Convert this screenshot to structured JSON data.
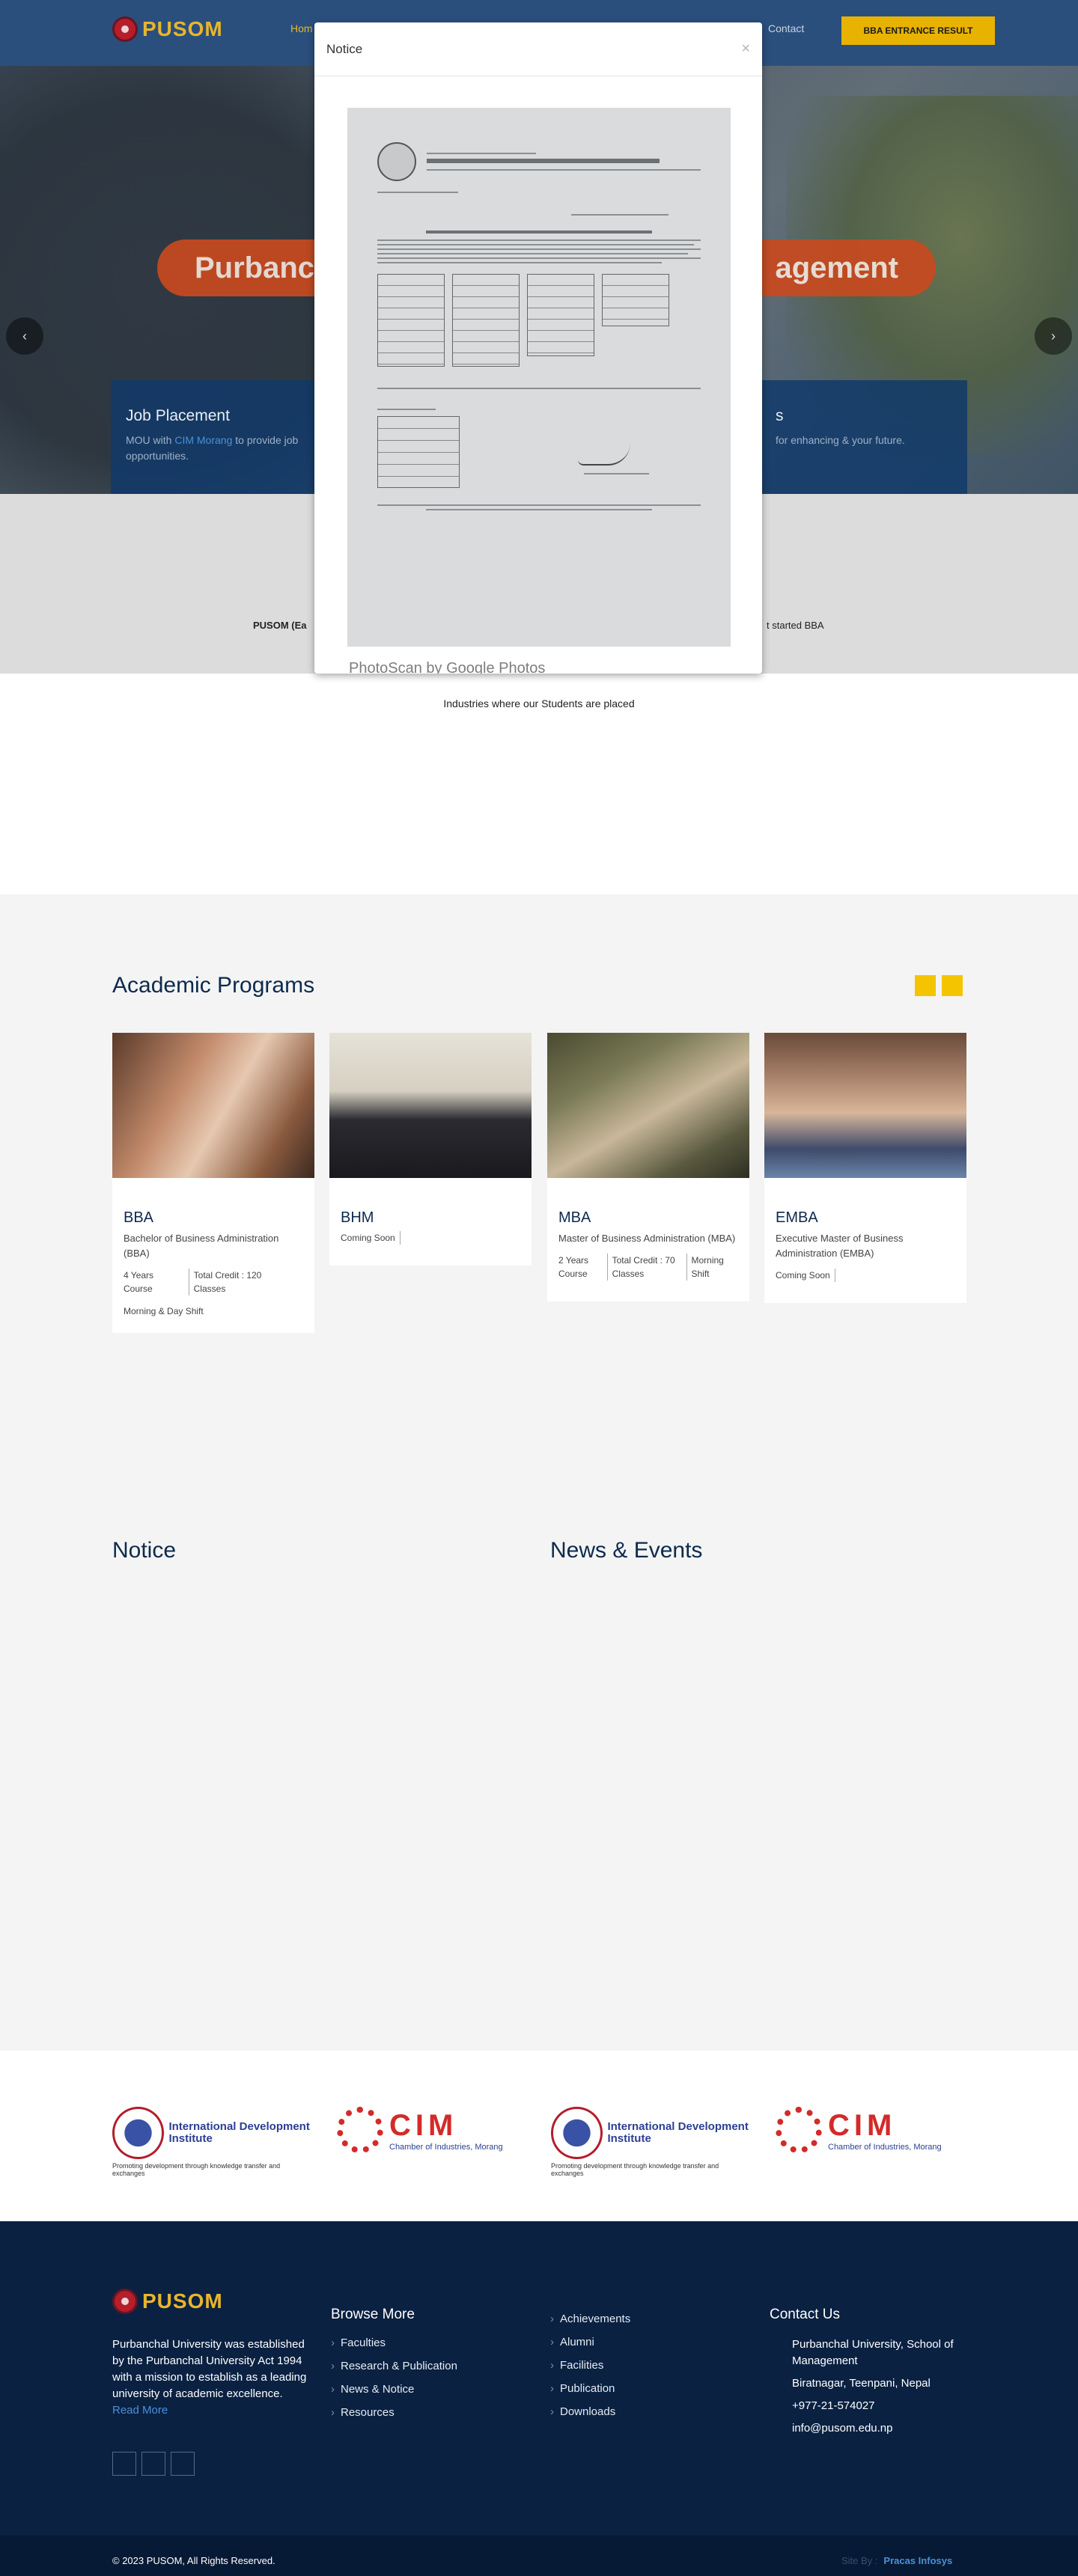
{
  "header": {
    "logo_text": "PUSOM",
    "nav_home": "Hom",
    "nav_contact": "Contact",
    "result_button": "BBA ENTRANCE RESULT"
  },
  "hero": {
    "title_left": "Purbanch",
    "title_right": "agement",
    "arrow_left": "‹",
    "arrow_right": "›",
    "features": [
      {
        "title": "Job Placement",
        "text_before": "MOU with ",
        "link": "CIM Morang",
        "text_after": " to provide job opportunities."
      },
      {
        "title": "s",
        "text": "for enhancing & your future."
      }
    ]
  },
  "intro": {
    "text_left": "PUSOM (Ea",
    "text_right": "t started BBA",
    "industries": "Industries where our Students are placed"
  },
  "modal": {
    "title": "Notice",
    "close": "×",
    "photoscan": "PhotoScan by Google Photos"
  },
  "academic": {
    "title": "Academic Programs",
    "programs": [
      {
        "code": "BBA",
        "name": "Bachelor of Business Administration (BBA)",
        "meta": [
          "4 Years Course",
          "Total Credit : 120 Classes"
        ],
        "shift": "Morning & Day Shift"
      },
      {
        "code": "BHM",
        "name": "",
        "meta": [
          "Coming Soon",
          ""
        ],
        "shift": ""
      },
      {
        "code": "MBA",
        "name": "Master of Business Administration (MBA)",
        "meta": [
          "2 Years Course",
          "Total Credit : 70 Classes",
          "Morning Shift"
        ],
        "shift": ""
      },
      {
        "code": "EMBA",
        "name": "Executive Master of Business Administration (EMBA)",
        "meta": [
          "Coming Soon",
          ""
        ],
        "shift": ""
      }
    ]
  },
  "notice_section": {
    "title": "Notice"
  },
  "news_section": {
    "title": "News & Events"
  },
  "partners": [
    {
      "name": "International Development Institute",
      "tagline": "Promoting development through knowledge transfer and exchanges"
    },
    {
      "name": "CIM",
      "tagline": "Chamber of Industries, Morang"
    },
    {
      "name": "International Development Institute",
      "tagline": "Promoting development through knowledge transfer and exchanges"
    },
    {
      "name": "CIM",
      "tagline": "Chamber of Industries, Morang"
    }
  ],
  "footer": {
    "logo_text": "PUSOM",
    "about": "Purbanchal University was established by the Purbanchal University Act 1994 with a mission to establish as a leading university of academic excellence.",
    "read_more": "Read More",
    "browse_title": "Browse More",
    "browse_links": [
      "Faculties",
      "Research & Publication",
      "News & Notice",
      "Resources"
    ],
    "more_links": [
      "Achievements",
      "Alumni",
      "Facilities",
      "Publication",
      "Downloads"
    ],
    "contact_title": "Contact Us",
    "contact": [
      "Purbanchal University, School of Management",
      "Biratnagar, Teenpani, Nepal",
      "+977-21-574027",
      "info@pusom.edu.np"
    ],
    "copyright": "© 2023 PUSOM, All Rights Reserved.",
    "site_by_label": "Site By :",
    "site_by": "Pracas Infosys"
  },
  "colors": {
    "primary": "#0a2142",
    "accent": "#f5c400",
    "header": "#2a4f7d"
  }
}
